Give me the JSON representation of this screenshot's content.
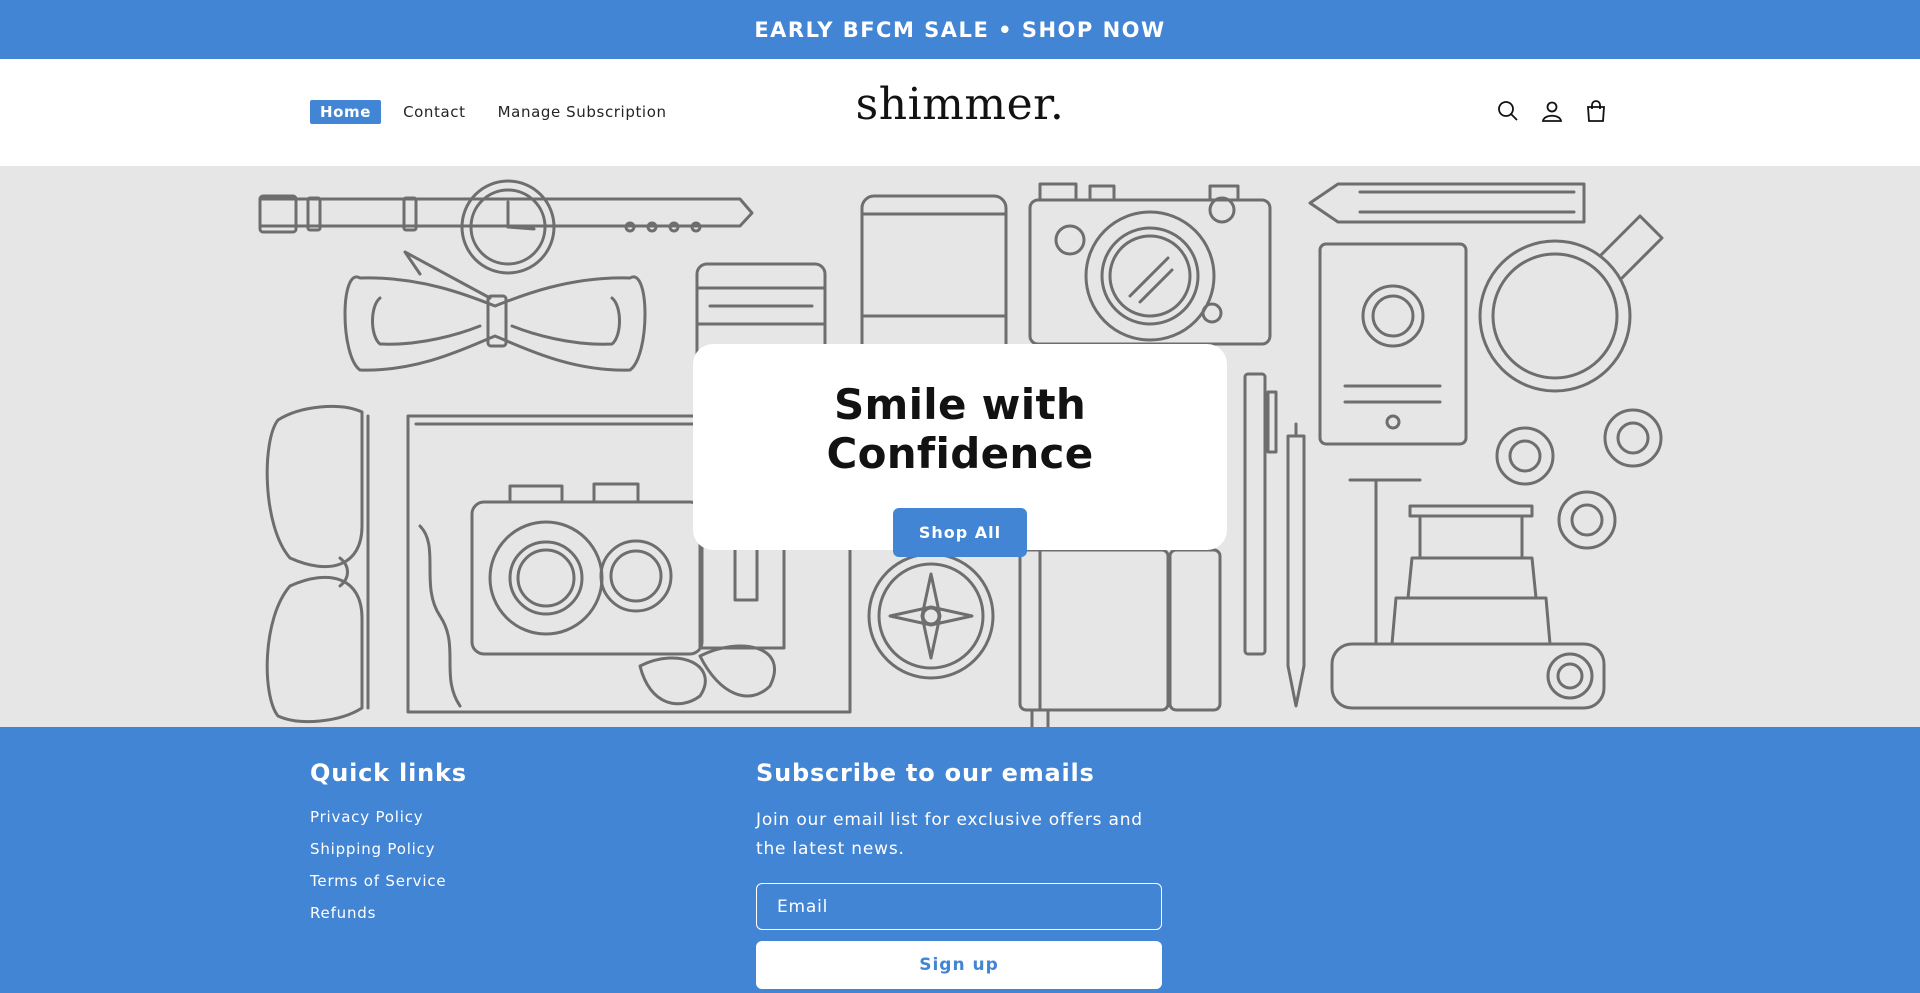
{
  "announcement": {
    "text": "EARLY BFCM SALE • SHOP NOW"
  },
  "header": {
    "nav": [
      {
        "label": "Home",
        "active": true
      },
      {
        "label": "Contact",
        "active": false
      },
      {
        "label": "Manage Subscription",
        "active": false
      }
    ],
    "logo": "shimmer.",
    "icons": [
      "search-icon",
      "account-icon",
      "cart-icon"
    ]
  },
  "hero": {
    "heading": "Smile with Confidence",
    "button_label": "Shop All",
    "background_color": "#e6e6e6"
  },
  "footer": {
    "quick_links": {
      "title": "Quick links",
      "items": [
        "Privacy Policy",
        "Shipping Policy",
        "Terms of Service",
        "Refunds"
      ]
    },
    "subscribe": {
      "title": "Subscribe to our emails",
      "description": "Join our email list for exclusive offers and the latest news.",
      "email_placeholder": "Email",
      "button_label": "Sign up"
    }
  },
  "colors": {
    "accent": "#4285d5",
    "text": "#121212",
    "white": "#ffffff"
  }
}
